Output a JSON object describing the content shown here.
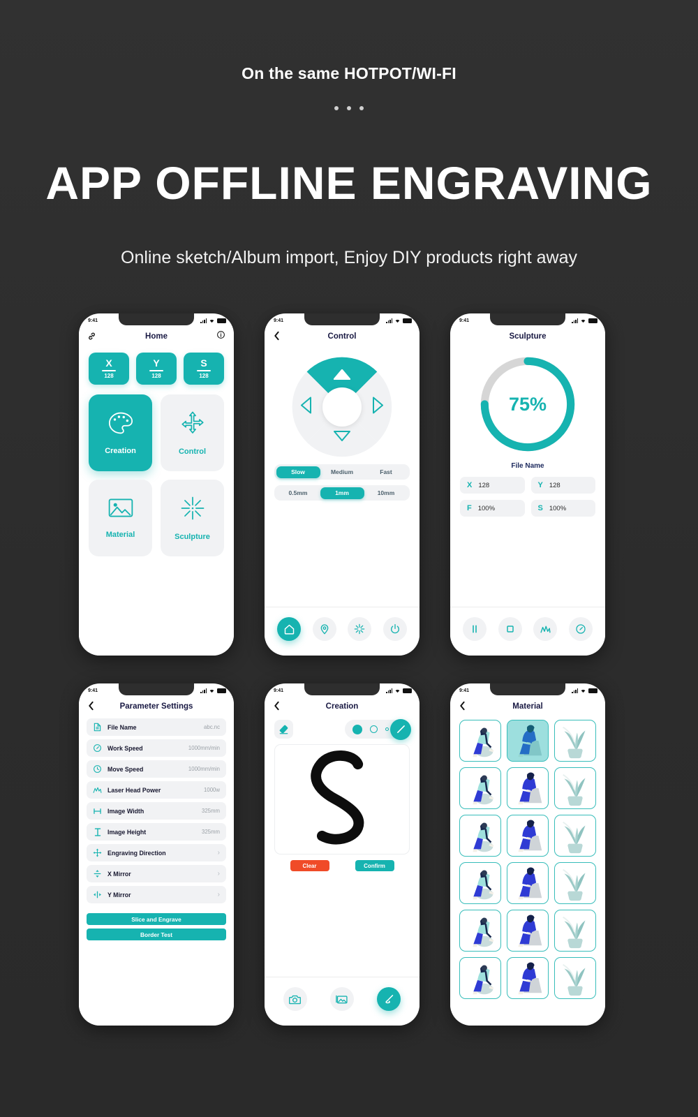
{
  "header": {
    "eyebrow": "On the same HOTPOT/WI-FI",
    "title": "APP OFFLINE ENGRAVING",
    "subtitle": "Online sketch/Album import, Enjoy DIY products right away"
  },
  "colors": {
    "accent": "#16b3b0",
    "background": "#2e2e2e",
    "title_navy": "#191943",
    "danger": "#f04b28",
    "muted": "#9aa0a6",
    "panel": "#f1f2f4"
  },
  "status_bar": {
    "time": "9:41"
  },
  "home": {
    "title": "Home",
    "link_icon": "link-icon",
    "info_icon": "info-icon",
    "axes": [
      {
        "key": "X",
        "value": "128"
      },
      {
        "key": "Y",
        "value": "128"
      },
      {
        "key": "S",
        "value": "128"
      }
    ],
    "tiles": [
      {
        "label": "Creation",
        "icon": "palette-icon",
        "active": true
      },
      {
        "label": "Control",
        "icon": "move-arrows-icon",
        "active": false
      },
      {
        "label": "Material",
        "icon": "image-icon",
        "active": false
      },
      {
        "label": "Sculpture",
        "icon": "laser-burst-icon",
        "active": false
      }
    ]
  },
  "control": {
    "title": "Control",
    "back_icon": "chevron-left-icon",
    "dpad": {
      "active_direction": "up",
      "up": "up-arrow-icon",
      "down": "down-arrow-icon",
      "left": "left-arrow-icon",
      "right": "right-arrow-icon"
    },
    "speed_options": [
      {
        "label": "Slow",
        "active": true
      },
      {
        "label": "Medium",
        "active": false
      },
      {
        "label": "Fast",
        "active": false
      }
    ],
    "step_options": [
      {
        "label": "0.5mm",
        "active": false
      },
      {
        "label": "1mm",
        "active": true
      },
      {
        "label": "10mm",
        "active": false
      }
    ],
    "tabs": [
      {
        "icon": "home-icon",
        "active": true
      },
      {
        "icon": "location-icon",
        "active": false
      },
      {
        "icon": "laser-burst-icon",
        "active": false
      },
      {
        "icon": "power-icon",
        "active": false
      }
    ]
  },
  "sculpture": {
    "title": "Sculpture",
    "progress_percent": 75,
    "progress_label": "75%",
    "file_name_label": "File Name",
    "values": [
      {
        "key": "X",
        "value": "128"
      },
      {
        "key": "Y",
        "value": "128"
      },
      {
        "key": "F",
        "value": "100%"
      },
      {
        "key": "S",
        "value": "100%"
      }
    ],
    "tabs": [
      {
        "icon": "pause-icon"
      },
      {
        "icon": "stop-icon"
      },
      {
        "icon": "power-curve-icon"
      },
      {
        "icon": "speed-gauge-icon"
      }
    ]
  },
  "parameters": {
    "title": "Parameter Settings",
    "back_icon": "chevron-left-icon",
    "rows": [
      {
        "icon": "file-icon",
        "name": "File Name",
        "value": "abc.nc",
        "chevron": false
      },
      {
        "icon": "speed-gauge-icon",
        "name": "Work Speed",
        "value": "1000mm/min",
        "chevron": false
      },
      {
        "icon": "clock-icon",
        "name": "Move Speed",
        "value": "1000mm/min",
        "chevron": false
      },
      {
        "icon": "power-curve-icon",
        "name": "Laser Head Power",
        "value": "1000w",
        "chevron": false
      },
      {
        "icon": "width-icon",
        "name": "Image Width",
        "value": "325mm",
        "chevron": false
      },
      {
        "icon": "height-icon",
        "name": "Image Height",
        "value": "325mm",
        "chevron": false
      },
      {
        "icon": "move-arrows-icon",
        "name": "Engraving Direction",
        "value": "",
        "chevron": true
      },
      {
        "icon": "x-mirror-icon",
        "name": "X Mirror",
        "value": "",
        "chevron": true
      },
      {
        "icon": "y-mirror-icon",
        "name": "Y Mirror",
        "value": "",
        "chevron": true
      }
    ],
    "buttons": [
      {
        "label": "Slice and Engrave"
      },
      {
        "label": "Border Test"
      }
    ]
  },
  "creation": {
    "title": "Creation",
    "back_icon": "chevron-left-icon",
    "eraser_icon": "eraser-icon",
    "brush_sizes": [
      {
        "size": "large",
        "selected": true
      },
      {
        "size": "medium",
        "selected": false
      },
      {
        "size": "small",
        "selected": false
      }
    ],
    "pen_icon": "pen-icon",
    "canvas_stroke": "letter-s-sketch",
    "buttons": [
      {
        "label": "Clear",
        "style": "danger"
      },
      {
        "label": "Confirm",
        "style": "accent"
      }
    ],
    "tabs": [
      {
        "icon": "camera-icon",
        "active": false
      },
      {
        "icon": "gallery-icon",
        "active": false
      },
      {
        "icon": "draw-icon",
        "active": true
      }
    ]
  },
  "material": {
    "title": "Material",
    "back_icon": "chevron-left-icon",
    "items": [
      {
        "art": "person-lean",
        "selected": false
      },
      {
        "art": "person-sit",
        "selected": true
      },
      {
        "art": "plant",
        "selected": false
      },
      {
        "art": "person-lean",
        "selected": false
      },
      {
        "art": "person-sit",
        "selected": false
      },
      {
        "art": "plant",
        "selected": false
      },
      {
        "art": "person-lean",
        "selected": false
      },
      {
        "art": "person-sit",
        "selected": false
      },
      {
        "art": "plant",
        "selected": false
      },
      {
        "art": "person-lean",
        "selected": false
      },
      {
        "art": "person-sit",
        "selected": false
      },
      {
        "art": "plant",
        "selected": false
      },
      {
        "art": "person-lean",
        "selected": false
      },
      {
        "art": "person-sit",
        "selected": false
      },
      {
        "art": "plant",
        "selected": false
      },
      {
        "art": "person-lean",
        "selected": false
      },
      {
        "art": "person-sit",
        "selected": false
      },
      {
        "art": "plant",
        "selected": false
      }
    ]
  }
}
